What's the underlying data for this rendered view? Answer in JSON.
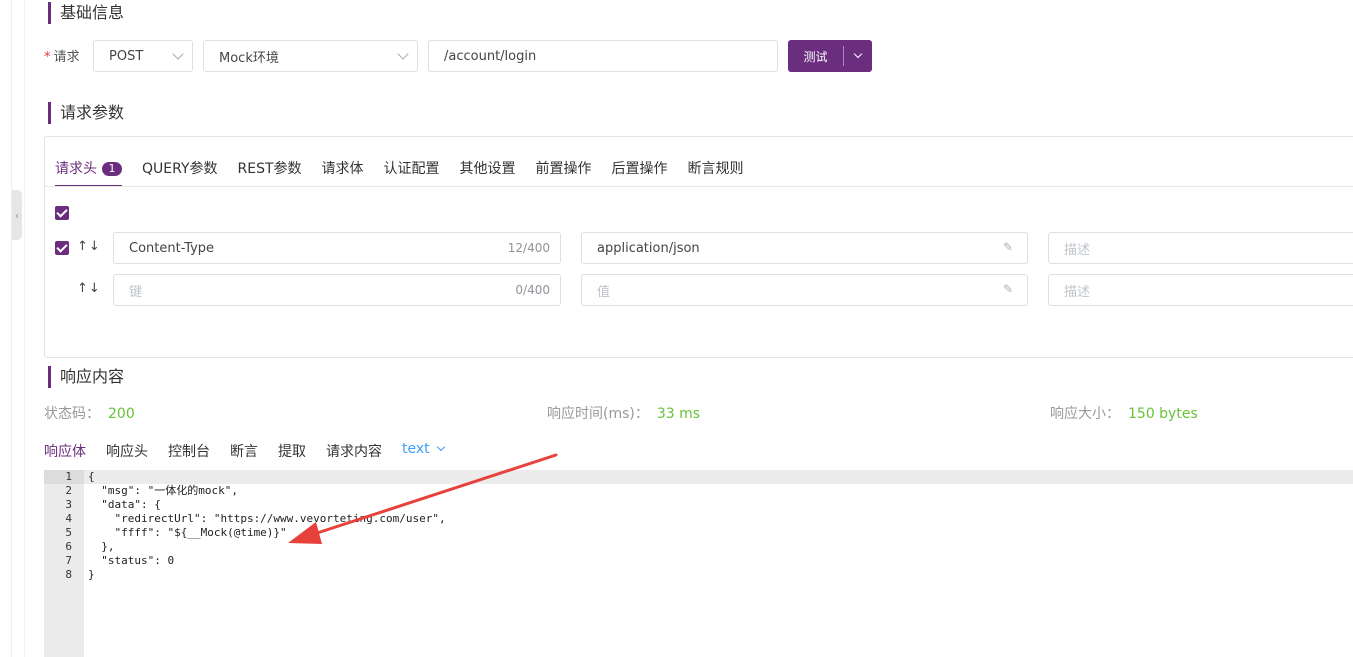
{
  "sections": {
    "basic_info": "基础信息",
    "request_params": "请求参数",
    "response": "响应内容"
  },
  "request": {
    "label": "请求",
    "required_mark": "*",
    "method": "POST",
    "environment": "Mock环境",
    "url": "/account/login",
    "test_button": "测试"
  },
  "param_tabs": {
    "items": [
      "请求头",
      "QUERY参数",
      "REST参数",
      "请求体",
      "认证配置",
      "其他设置",
      "前置操作",
      "后置操作",
      "断言规则"
    ],
    "active_badge": "1"
  },
  "headers": {
    "rows": [
      {
        "key": "Content-Type",
        "key_count": "12/400",
        "value": "application/json",
        "desc_placeholder": "描述",
        "checked": true
      },
      {
        "key_placeholder": "键",
        "key_count": "0/400",
        "value_placeholder": "值",
        "desc_placeholder": "描述",
        "checked": false
      }
    ],
    "sort_arrows": "↑↓"
  },
  "response": {
    "status_label": "状态码：",
    "status_value": "200",
    "time_label": "响应时间(ms)：",
    "time_value": "33 ms",
    "size_label": "响应大小：",
    "size_value": "150 bytes",
    "tabs": [
      "响应体",
      "响应头",
      "控制台",
      "断言",
      "提取",
      "请求内容"
    ],
    "format": "text"
  },
  "editor": {
    "lines": [
      {
        "n": "1",
        "code": "{"
      },
      {
        "n": "2",
        "code": "  \"msg\": \"一体化的mock\","
      },
      {
        "n": "3",
        "code": "  \"data\": {"
      },
      {
        "n": "4",
        "code": "    \"redirectUrl\": \"https://www.vevorteting.com/user\","
      },
      {
        "n": "5",
        "code": "    \"ffff\": \"${__Mock(@time)}\""
      },
      {
        "n": "6",
        "code": "  },"
      },
      {
        "n": "7",
        "code": "  \"status\": 0"
      },
      {
        "n": "8",
        "code": "}"
      }
    ]
  },
  "colors": {
    "brand": "#6b2d7e",
    "success": "#67c23a",
    "link": "#409eff",
    "annotation_arrow": "#e8413c"
  }
}
